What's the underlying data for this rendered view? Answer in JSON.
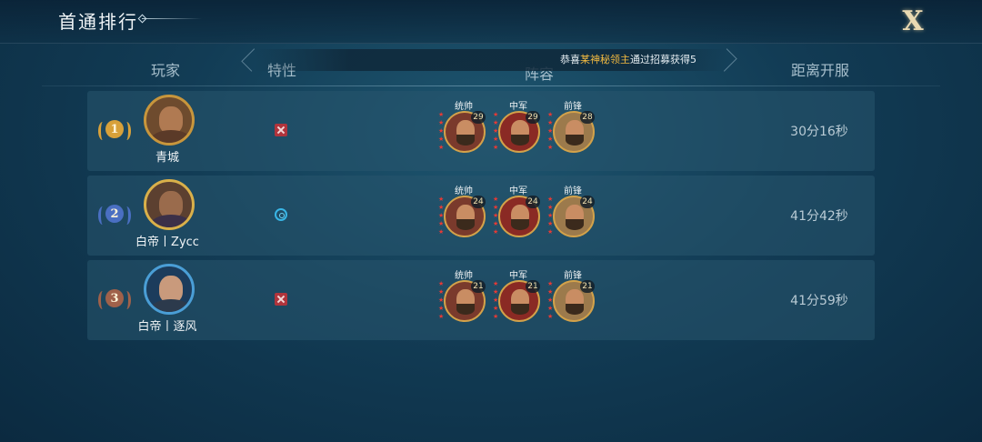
{
  "window": {
    "title": "首通排行",
    "close_label": "X"
  },
  "headers": {
    "player": "玩家",
    "trait": "特性",
    "lineup": "阵容",
    "time": "距离开服"
  },
  "marquee": {
    "prefix": "恭喜",
    "highlight": "某神秘领主",
    "suffix": "通过招募获得5"
  },
  "roles": [
    "统帅",
    "中军",
    "前锋"
  ],
  "rows": [
    {
      "rank": "1",
      "name": "青城",
      "trait_icon": "red-x-icon",
      "levels": [
        "29",
        "29",
        "28"
      ],
      "time": "30分16秒",
      "rank_color": "#d8a13a"
    },
    {
      "rank": "2",
      "name": "白帝丨Zycc",
      "trait_icon": "blue-swirl-icon",
      "levels": [
        "24",
        "24",
        "24"
      ],
      "time": "41分42秒",
      "rank_color": "#4a6fc2"
    },
    {
      "rank": "3",
      "name": "白帝丨逐风",
      "trait_icon": "red-x-icon",
      "levels": [
        "21",
        "21",
        "21"
      ],
      "time": "41分59秒",
      "rank_color": "#a0614a"
    }
  ]
}
